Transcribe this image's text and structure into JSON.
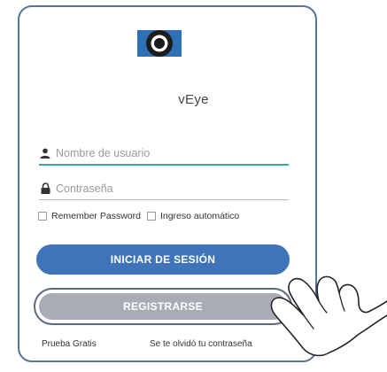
{
  "app": {
    "name": "vEye",
    "icon": "camera-lens-icon",
    "accent_color": "#3f74b8"
  },
  "login": {
    "username_placeholder": "Nombre de usuario",
    "username_icon": "user-icon",
    "password_placeholder": "Contraseña",
    "password_icon": "lock-icon",
    "remember_label": "Remember Password",
    "auto_login_label": "Ingreso automático",
    "login_button": "INICIAR DE SESIÓN",
    "register_button": "REGISTRARSE",
    "free_trial_link": "Prueba Gratis",
    "forgot_link": "Se te olvidó tu contraseña"
  },
  "overlay": {
    "pointer_icon": "tapping-hand-icon"
  }
}
